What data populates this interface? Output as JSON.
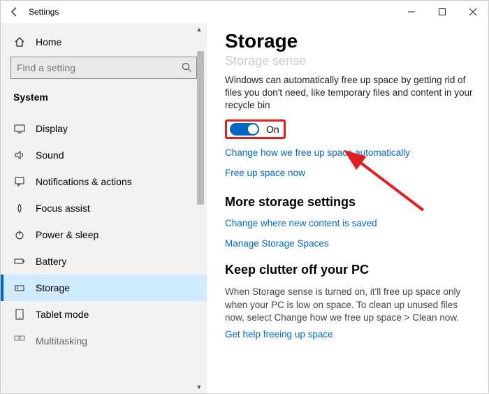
{
  "window": {
    "title": "Settings"
  },
  "sidebar": {
    "home": "Home",
    "search_placeholder": "Find a setting",
    "section": "System",
    "items": [
      {
        "label": "Display"
      },
      {
        "label": "Sound"
      },
      {
        "label": "Notifications & actions"
      },
      {
        "label": "Focus assist"
      },
      {
        "label": "Power & sleep"
      },
      {
        "label": "Battery"
      },
      {
        "label": "Storage"
      },
      {
        "label": "Tablet mode"
      },
      {
        "label": "Multitasking"
      }
    ]
  },
  "main": {
    "title": "Storage",
    "truncated_subhead": "Storage sense",
    "desc": "Windows can automatically free up space by getting rid of files you don't need, like temporary files and content in your recycle bin",
    "toggle": {
      "state": "On"
    },
    "link_change": "Change how we free up space automatically",
    "link_free_now": "Free up space now",
    "more_head": "More storage settings",
    "link_new_content": "Change where new content is saved",
    "link_spaces": "Manage Storage Spaces",
    "keep_head": "Keep clutter off your PC",
    "keep_desc": "When Storage sense is turned on, it'll free up space only when your PC is low on space. To clean up unused files now, select Change how we free up space > Clean now.",
    "link_help": "Get help freeing up space"
  }
}
